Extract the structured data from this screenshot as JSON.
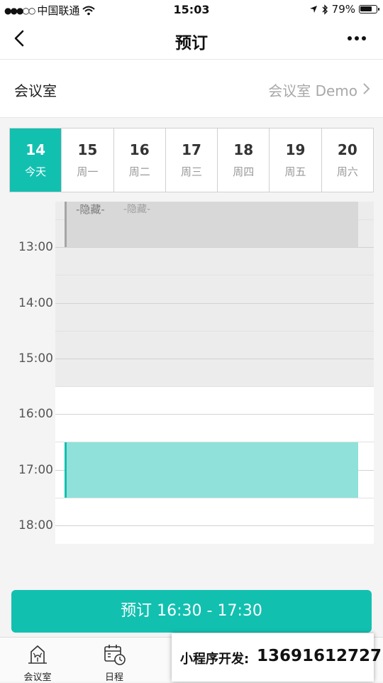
{
  "status_bar": {
    "carrier": "中国联通",
    "time": "15:03",
    "battery": "79%",
    "battery_level": 0.79
  },
  "nav": {
    "title": "预订"
  },
  "room": {
    "label": "会议室",
    "value": "会议室 Demo"
  },
  "dates": [
    {
      "num": "14",
      "week": "今天",
      "active": true
    },
    {
      "num": "15",
      "week": "周一",
      "active": false
    },
    {
      "num": "16",
      "week": "周二",
      "active": false
    },
    {
      "num": "17",
      "week": "周三",
      "active": false
    },
    {
      "num": "18",
      "week": "周四",
      "active": false
    },
    {
      "num": "19",
      "week": "周五",
      "active": false
    },
    {
      "num": "20",
      "week": "周六",
      "active": false
    }
  ],
  "schedule": {
    "times": [
      "13:00",
      "14:00",
      "15:00",
      "16:00",
      "17:00",
      "18:00"
    ],
    "hidden_event": {
      "title": "-隐藏-",
      "subtitle": "-隐藏-"
    }
  },
  "book_button": {
    "label": "预订 16:30 - 17:30"
  },
  "tabs": [
    {
      "label": "会议室",
      "icon": "building-icon"
    },
    {
      "label": "日程",
      "icon": "calendar-clock-icon"
    }
  ],
  "overlay": {
    "label": "小程序开发:",
    "phone": "13691612727"
  },
  "colors": {
    "accent": "#12c0b0",
    "booking_fill": "#8fe1d9",
    "hidden_fill": "#d8d8d8"
  }
}
